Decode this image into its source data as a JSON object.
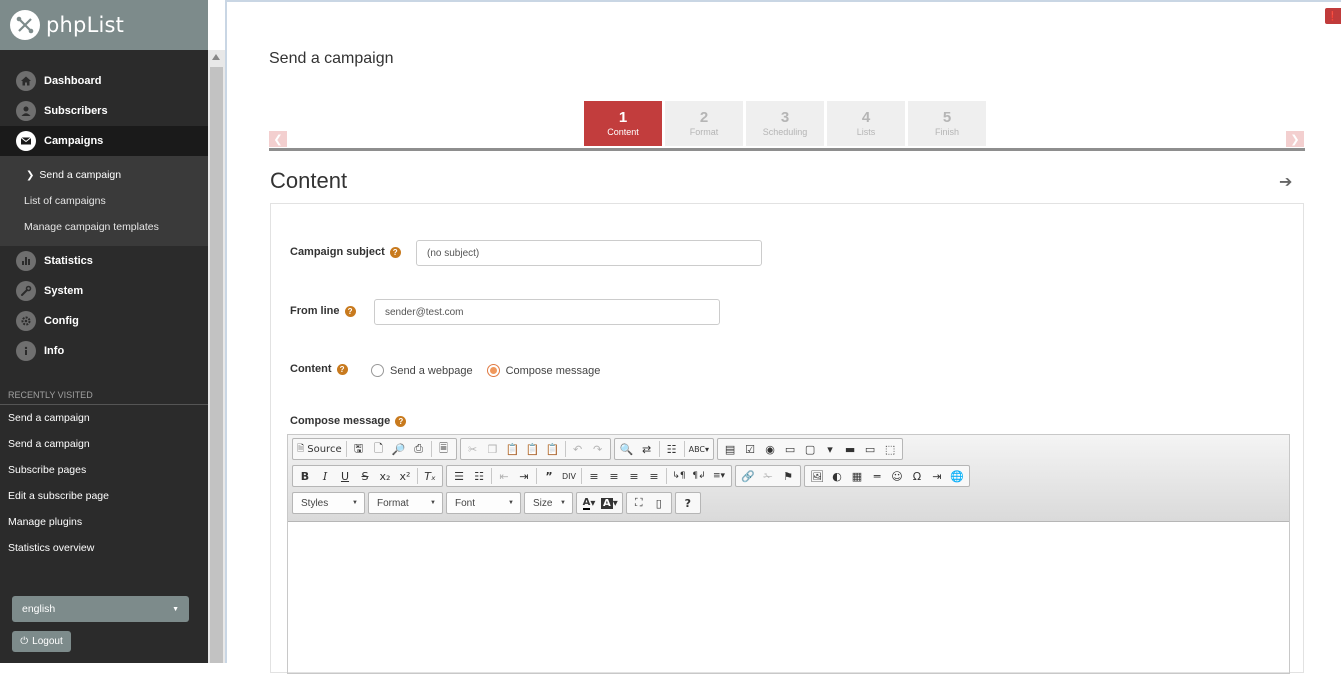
{
  "app": {
    "name": "phpList"
  },
  "sidebar": {
    "items": [
      {
        "label": "Dashboard",
        "icon": "home-icon"
      },
      {
        "label": "Subscribers",
        "icon": "user-icon"
      },
      {
        "label": "Campaigns",
        "icon": "envelope-icon",
        "active": true
      }
    ],
    "subitems": [
      {
        "label": "Send a campaign",
        "current": true
      },
      {
        "label": "List of campaigns"
      },
      {
        "label": "Manage campaign templates"
      }
    ],
    "items2": [
      {
        "label": "Statistics",
        "icon": "bar-chart-icon"
      },
      {
        "label": "System",
        "icon": "wrench-icon"
      },
      {
        "label": "Config",
        "icon": "gear-icon"
      },
      {
        "label": "Info",
        "icon": "info-icon"
      }
    ],
    "recent_title": "RECENTLY VISITED",
    "recent": [
      "Send a campaign",
      "Send a campaign",
      "Subscribe pages",
      "Edit a subscribe page",
      "Manage plugins",
      "Statistics overview"
    ],
    "language": "english",
    "logout": "Logout"
  },
  "main": {
    "title": "Send a campaign",
    "steps": [
      {
        "num": "1",
        "label": "Content",
        "active": true
      },
      {
        "num": "2",
        "label": "Format"
      },
      {
        "num": "3",
        "label": "Scheduling"
      },
      {
        "num": "4",
        "label": "Lists"
      },
      {
        "num": "5",
        "label": "Finish"
      }
    ],
    "section_heading": "Content",
    "form": {
      "subject_label": "Campaign subject",
      "subject_value": "(no subject)",
      "from_label": "From line",
      "from_value": "sender@test.com",
      "content_label": "Content",
      "radio_webpage": "Send a webpage",
      "radio_compose": "Compose message",
      "compose_label": "Compose message"
    },
    "editor": {
      "source_label": "Source",
      "styles": "Styles",
      "format": "Format",
      "font": "Font",
      "size": "Size"
    }
  },
  "colors": {
    "accent": "#c23d3d",
    "sidebar_bg": "#2b2b2b",
    "logo_bar": "#7d8b8b",
    "help": "#c87a1e"
  }
}
